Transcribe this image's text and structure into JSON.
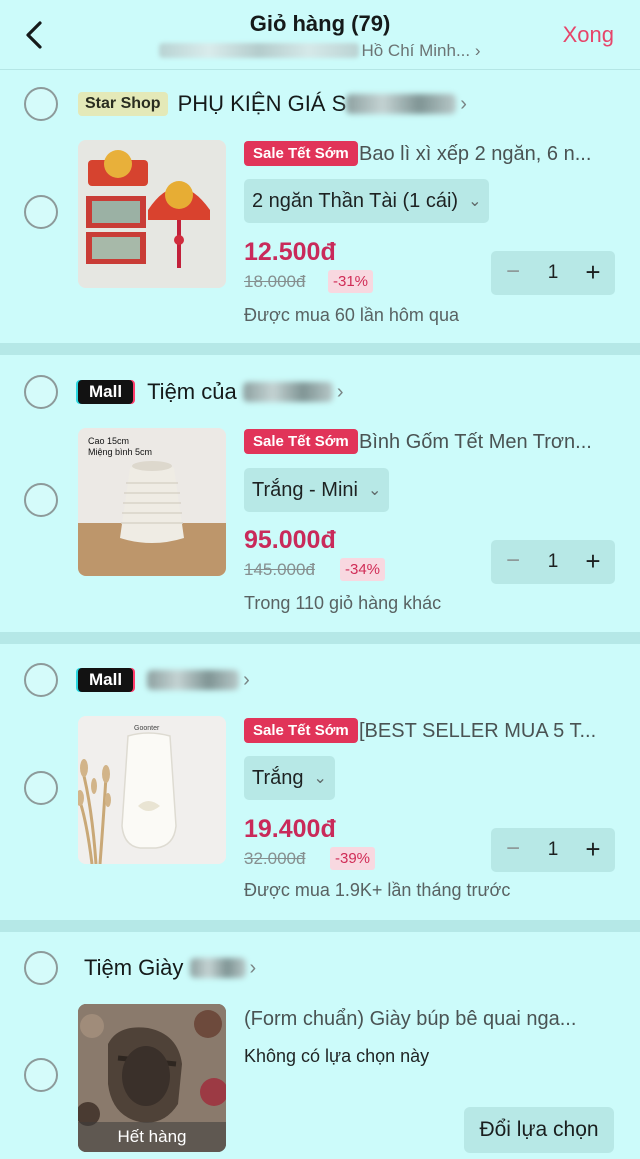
{
  "header": {
    "title": "Giỏ hàng (79)",
    "subtitle": "Hồ Chí Minh...",
    "subtitle_chevron": "›",
    "done": "Xong"
  },
  "colors": {
    "accent": "#e6456a",
    "price": "#c92a5a",
    "sale_badge": "#e13459",
    "background": "#ccfbfa"
  },
  "shops": [
    {
      "badge": "Star Shop",
      "name": "PHỤ KIỆN GIÁ S",
      "product": {
        "sale_tag": "Sale Tết Sớm",
        "name": "Bao lì xì xếp 2 ngăn, 6 n...",
        "variant": "2 ngăn Thần Tài (1 cái)",
        "price": "12.500đ",
        "old_price": "18.000đ",
        "discount": "-31%",
        "quantity": "1",
        "note": "Được mua 60 lần hôm qua"
      }
    },
    {
      "badge": "Mall",
      "name": "Tiệm của",
      "product": {
        "sale_tag": "Sale Tết Sớm",
        "name": "Bình Gốm Tết Men Trơn...",
        "variant": "Trắng - Mini",
        "price": "95.000đ",
        "old_price": "145.000đ",
        "discount": "-34%",
        "quantity": "1",
        "note": "Trong 110 giỏ hàng khác",
        "image_text_1": "Cao 15cm",
        "image_text_2": "Miệng bình 5cm"
      }
    },
    {
      "badge": "Mall",
      "name": "",
      "product": {
        "sale_tag": "Sale Tết Sớm",
        "name": "[BEST SELLER MUA 5 T...",
        "variant": "Trắng",
        "price": "19.400đ",
        "old_price": "32.000đ",
        "discount": "-39%",
        "quantity": "1",
        "note": "Được mua 1.9K+ lần tháng trước",
        "image_text_1": "Goonter"
      }
    },
    {
      "badge": "",
      "name": "Tiệm Giày",
      "product": {
        "name": "(Form chuẩn) Giày búp bê quai nga...",
        "note": "Không có lựa chọn này",
        "change_button": "Đổi lựa chọn",
        "soldout": "Hết hàng"
      }
    }
  ],
  "stepper": {
    "minus": "−",
    "plus": "+"
  },
  "chevron": "›",
  "dropdown": "⌄"
}
